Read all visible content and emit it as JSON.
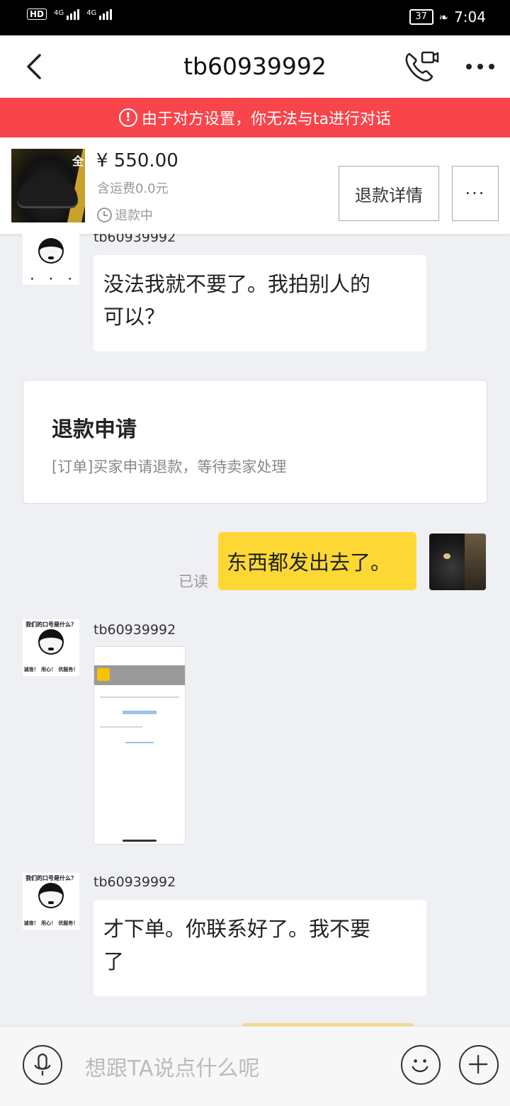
{
  "status_bar": {
    "left_badge": "HD",
    "network_1": "4G",
    "network_2": "4G",
    "battery": "37",
    "time": "7:04"
  },
  "header": {
    "title": "tb60939992"
  },
  "banner": {
    "text": "由于对方设置，你无法与ta进行对话"
  },
  "product": {
    "price": "¥ 550.00",
    "shipping": "含运费0.0元",
    "status": "退款中",
    "thumb_corner_text": "全",
    "refund_button": "退款详情",
    "more_button": "···"
  },
  "messages": {
    "m1": {
      "sender": "tb60939992",
      "text_line1": "没法我就不要了。我拍别人的",
      "text_line2": "可以？"
    },
    "card": {
      "title": "退款申请",
      "subtitle": "[订单]买家申请退款，等待卖家处理"
    },
    "m2": {
      "text": "东西都发出去了。",
      "read_status": "已读"
    },
    "m3": {
      "sender": "tb60939992",
      "avatar_caption": "我们的口号是什么？",
      "avatar_tag_1": "诚信！",
      "avatar_tag_2": "用心！",
      "avatar_tag_3": "优服务！"
    },
    "m4": {
      "sender": "tb60939992",
      "avatar_caption": "我们的口号是什么？",
      "avatar_tag_1": "诚信！",
      "avatar_tag_2": "用心！",
      "avatar_tag_3": "优服务！",
      "text_line1": "才下单。你联系好了。我不要",
      "text_line2": "了"
    }
  },
  "composer": {
    "placeholder": "想跟TA说点什么呢"
  },
  "colors": {
    "banner_red": "#f7454b",
    "my_bubble_yellow": "#fdd835",
    "chat_background": "#eef0f4"
  },
  "icons": [
    "back-arrow-icon",
    "video-call-icon",
    "more-dots-icon",
    "warning-icon",
    "clock-icon",
    "microphone-icon",
    "emoji-icon",
    "plus-icon"
  ]
}
